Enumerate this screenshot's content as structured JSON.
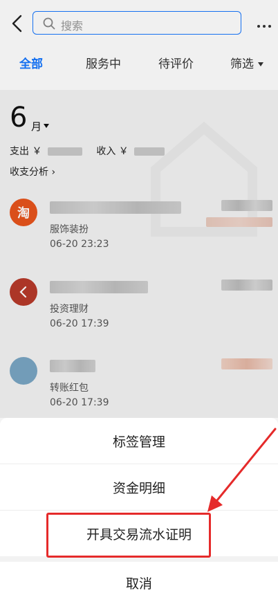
{
  "header": {
    "search_placeholder": "搜索"
  },
  "tabs": [
    {
      "label": "全部",
      "active": true
    },
    {
      "label": "服务中",
      "active": false
    },
    {
      "label": "待评价",
      "active": false
    },
    {
      "label": "筛选",
      "active": false
    }
  ],
  "summary": {
    "month_number": "6",
    "month_unit": "月",
    "expense_label": "支出 ￥",
    "income_label": "收入 ￥",
    "analysis_link": "收支分析 ›"
  },
  "transactions": [
    {
      "avatar_text": "淘",
      "avatar_color": "#e8541c",
      "category": "服饰装扮",
      "time": "06-20  23:23"
    },
    {
      "avatar_text": "",
      "avatar_color": "#b73a2a",
      "category": "投资理财",
      "time": "06-20  17:39"
    },
    {
      "avatar_text": "",
      "avatar_color": "#7aa6c4",
      "category": "转账红包",
      "time": "06-20  17:39"
    }
  ],
  "action_sheet": {
    "items": [
      "标签管理",
      "资金明细",
      "开具交易流水证明"
    ],
    "cancel": "取消"
  },
  "colors": {
    "accent": "#1677ff",
    "annotation": "#e52a2a"
  }
}
